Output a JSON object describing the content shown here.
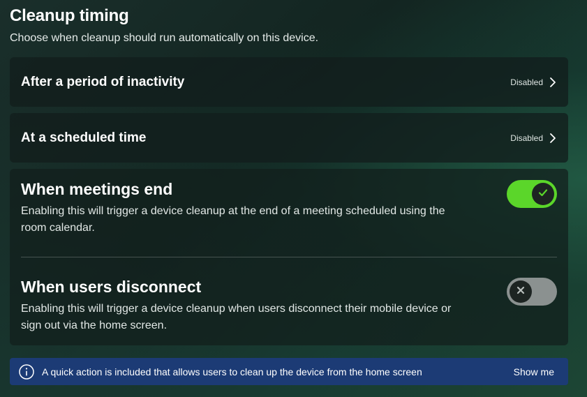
{
  "header": {
    "title": "Cleanup timing",
    "subtitle": "Choose when cleanup should run automatically on this device."
  },
  "rows": [
    {
      "label": "After a period of inactivity",
      "status": "Disabled",
      "icon": "chevron-right-icon"
    },
    {
      "label": "At a scheduled time",
      "status": "Disabled",
      "icon": "chevron-right-icon"
    }
  ],
  "toggles": [
    {
      "heading": "When meetings end",
      "description": "Enabling this will trigger a device cleanup at the end of a meeting scheduled using the room calendar.",
      "state": "on",
      "icon": "check-icon",
      "color": "#5bd62a"
    },
    {
      "heading": "When users disconnect",
      "description": "Enabling this will trigger a device cleanup when users disconnect their mobile device or sign out via the home screen.",
      "state": "off",
      "icon": "close-icon",
      "color": "#8b9190"
    }
  ],
  "banner": {
    "icon": "info-icon",
    "message": "A quick action is included that allows users to clean up the device from the home screen",
    "action": "Show me",
    "color": "#1c3b75"
  }
}
